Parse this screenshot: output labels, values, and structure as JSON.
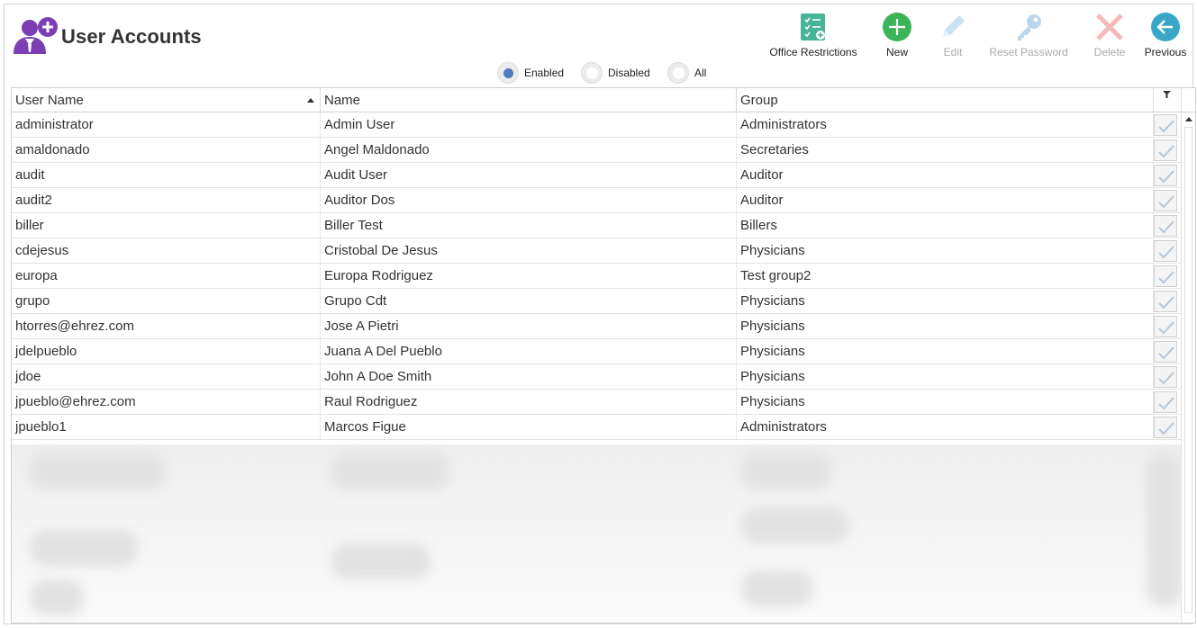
{
  "app": {
    "title": "User Accounts",
    "icon": "user-add-icon"
  },
  "toolbar": {
    "office_restrictions": {
      "label": "Office Restrictions",
      "icon": "checklist-icon",
      "enabled": true
    },
    "new": {
      "label": "New",
      "icon": "plus-circle-icon",
      "enabled": true
    },
    "edit": {
      "label": "Edit",
      "icon": "pencil-icon",
      "enabled": false
    },
    "reset_password": {
      "label": "Reset Password",
      "icon": "key-icon",
      "enabled": false
    },
    "delete": {
      "label": "Delete",
      "icon": "x-icon",
      "enabled": false
    },
    "previous": {
      "label": "Previous",
      "icon": "arrow-left-circle-icon",
      "enabled": true
    }
  },
  "filter": {
    "options": [
      {
        "label": "Enabled",
        "selected": true
      },
      {
        "label": "Disabled",
        "selected": false
      },
      {
        "label": "All",
        "selected": false
      }
    ]
  },
  "grid": {
    "columns": [
      "User Name",
      "Name",
      "Group"
    ],
    "sort": {
      "column": "User Name",
      "direction": "ascending"
    },
    "rows": [
      {
        "user": "administrator",
        "name": "Admin User",
        "group": "Administrators",
        "active": true
      },
      {
        "user": "amaldonado",
        "name": "Angel Maldonado",
        "group": "Secretaries",
        "active": true
      },
      {
        "user": "audit",
        "name": "Audit User",
        "group": "Auditor",
        "active": true
      },
      {
        "user": "audit2",
        "name": "Auditor Dos",
        "group": "Auditor",
        "active": true
      },
      {
        "user": "biller",
        "name": "Biller Test",
        "group": "Billers",
        "active": true
      },
      {
        "user": "cdejesus",
        "name": "Cristobal De Jesus",
        "group": "Physicians",
        "active": true
      },
      {
        "user": "europa",
        "name": "Europa Rodriguez",
        "group": "Test group2",
        "active": true
      },
      {
        "user": "grupo",
        "name": "Grupo Cdt",
        "group": "Physicians",
        "active": true
      },
      {
        "user": "htorres@ehrez.com",
        "name": "Jose A Pietri",
        "group": "Physicians",
        "active": true
      },
      {
        "user": "jdelpueblo",
        "name": "Juana A Del Pueblo",
        "group": "Physicians",
        "active": true
      },
      {
        "user": "jdoe",
        "name": "John A Doe Smith",
        "group": "Physicians",
        "active": true
      },
      {
        "user": "jpueblo@ehrez.com",
        "name": "Raul Rodriguez",
        "group": "Physicians",
        "active": true
      },
      {
        "user": "jpueblo1",
        "name": "Marcos Figue",
        "group": "Administrators",
        "active": true
      }
    ]
  },
  "colors": {
    "accent": "#4f7bc3",
    "new_green": "#3cb45a",
    "previous_teal": "#3aa7c9",
    "user_icon_purple": "#7b3fb3"
  }
}
